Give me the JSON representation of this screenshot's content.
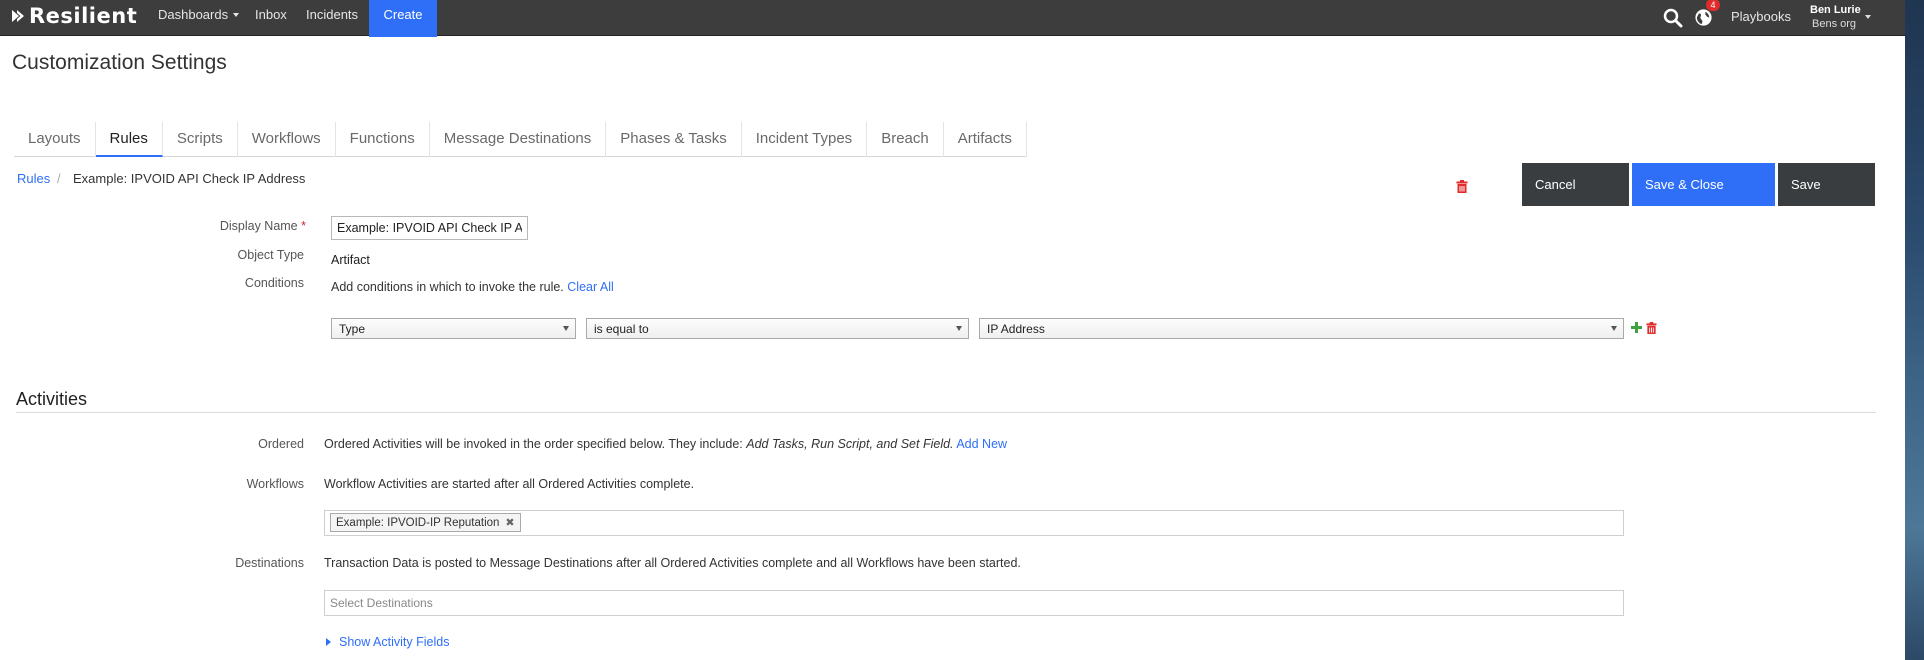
{
  "app": {
    "logo_text": "Resilient"
  },
  "nav": {
    "dashboards": "Dashboards",
    "inbox": "Inbox",
    "incidents": "Incidents",
    "create": "Create",
    "playbooks": "Playbooks",
    "notification_count": "4",
    "user_name": "Ben Lurie",
    "user_org": "Bens org"
  },
  "page": {
    "title": "Customization Settings"
  },
  "tabs": [
    {
      "label": "Layouts",
      "active": false
    },
    {
      "label": "Rules",
      "active": true
    },
    {
      "label": "Scripts",
      "active": false
    },
    {
      "label": "Workflows",
      "active": false
    },
    {
      "label": "Functions",
      "active": false
    },
    {
      "label": "Message Destinations",
      "active": false
    },
    {
      "label": "Phases & Tasks",
      "active": false
    },
    {
      "label": "Incident Types",
      "active": false
    },
    {
      "label": "Breach",
      "active": false
    },
    {
      "label": "Artifacts",
      "active": false
    }
  ],
  "breadcrumb": {
    "root": "Rules",
    "separator": "/",
    "current": "Example: IPVOID API Check IP Address"
  },
  "actions": {
    "cancel": "Cancel",
    "save_close": "Save & Close",
    "save": "Save"
  },
  "form": {
    "display_name_label": "Display Name",
    "required_marker": "*",
    "display_name_value": "Example: IPVOID API Check IP A",
    "object_type_label": "Object Type",
    "object_type_value": "Artifact",
    "conditions_label": "Conditions",
    "conditions_text": "Add conditions in which to invoke the rule.",
    "clear_all": "Clear All",
    "condition": {
      "field": "Type",
      "operator": "is equal to",
      "value": "IP Address"
    }
  },
  "activities": {
    "title": "Activities",
    "ordered_label": "Ordered",
    "ordered_text": "Ordered Activities will be invoked in the order specified below. They include:",
    "ordered_items": "Add Tasks, Run Script, and Set Field.",
    "add_new": "Add New",
    "workflows_label": "Workflows",
    "workflows_text": "Workflow Activities are started after all Ordered Activities complete.",
    "workflow_tag": "Example: IPVOID-IP Reputation",
    "destinations_label": "Destinations",
    "destinations_text": "Transaction Data is posted to Message Destinations after all Ordered Activities complete and all Workflows have been started.",
    "destinations_placeholder": "Select Destinations",
    "show_fields": "Show Activity Fields"
  },
  "colors": {
    "accent": "#2f6ff7",
    "topbar": "#3d3d3d",
    "dark_button": "#3a3d40",
    "danger": "#e12b2b",
    "add": "#3fa33f"
  },
  "icons": [
    "search-icon",
    "globe-icon",
    "trash-icon",
    "plus-icon",
    "chevron-down-icon",
    "close-icon",
    "caret-right-icon"
  ]
}
